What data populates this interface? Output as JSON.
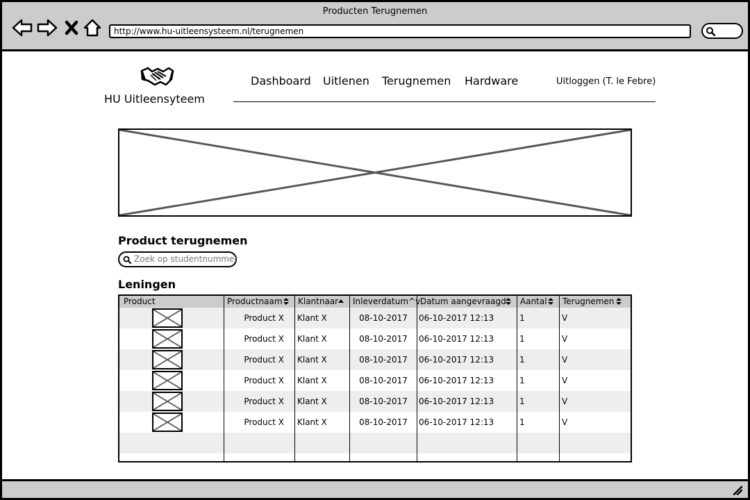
{
  "window": {
    "title": "Producten Terugnemen"
  },
  "browser": {
    "url": "http://www.hu-uitleensysteem.nl/terugnemen",
    "icons": [
      "back-arrow-icon",
      "forward-arrow-icon",
      "close-x-icon",
      "home-icon",
      "search-icon"
    ]
  },
  "header": {
    "logo_icon": "handshake-icon",
    "logo_text": "HU Uitleensyteem",
    "nav": [
      "Dashboard",
      "Uitlenen",
      "Terugnemen",
      "Hardware"
    ],
    "logout": "Uitloggen (T. le Febre)"
  },
  "section": {
    "title": "Product terugnemen",
    "search_placeholder": "Zoek op studentnummer"
  },
  "loans": {
    "title": "Leningen",
    "columns": [
      "Product",
      "Productnaam",
      "Klantnaar",
      "Inleverdatum^v",
      "Datum aangevraagd",
      "Aantal",
      "Terugnemen"
    ],
    "rows": [
      {
        "product": "Product X",
        "klant": "Klant X",
        "inlever": "08-10-2017",
        "aangevraagd": "06-10-2017 12:13",
        "aantal": "1",
        "terug": "V"
      },
      {
        "product": "Product X",
        "klant": "Klant X",
        "inlever": "08-10-2017",
        "aangevraagd": "06-10-2017 12:13",
        "aantal": "1",
        "terug": "V"
      },
      {
        "product": "Product X",
        "klant": "Klant X",
        "inlever": "08-10-2017",
        "aangevraagd": "06-10-2017 12:13",
        "aantal": "1",
        "terug": "V"
      },
      {
        "product": "Product X",
        "klant": "Klant X",
        "inlever": "08-10-2017",
        "aangevraagd": "06-10-2017 12:13",
        "aantal": "1",
        "terug": "V"
      },
      {
        "product": "Product X",
        "klant": "Klant X",
        "inlever": "08-10-2017",
        "aangevraagd": "06-10-2017 12:13",
        "aantal": "1",
        "terug": "V"
      },
      {
        "product": "Product X",
        "klant": "Klant X",
        "inlever": "08-10-2017",
        "aangevraagd": "06-10-2017 12:13",
        "aantal": "1",
        "terug": "V"
      }
    ]
  },
  "colors": {
    "chrome": "#cccccc",
    "row_alt": "#eeeeee",
    "border": "#000000",
    "placeholder_text": "#777777"
  }
}
